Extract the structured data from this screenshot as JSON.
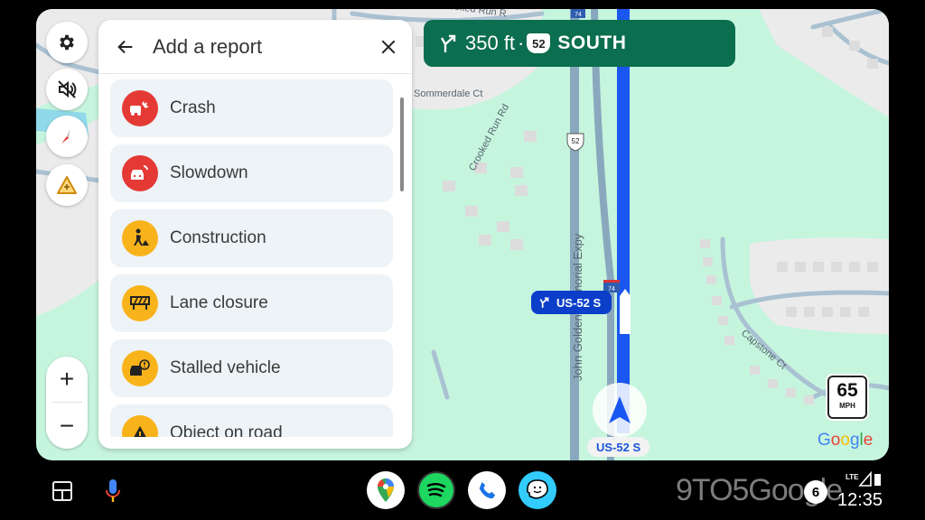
{
  "map": {
    "streets": [
      "Sommerdale Ct",
      "Crooked Run Rd",
      "John Golden Memorial Expy",
      "Capstone Ct",
      "Crooked Run Rd"
    ],
    "shields": [
      "52",
      "74",
      "74"
    ],
    "colors": {
      "land": "#c6f5de",
      "residential": "#ecebec",
      "road": "#9bb7c9",
      "route": "#1a56f0",
      "water": "#8fd9ea"
    }
  },
  "side_controls": {
    "settings": "gear-icon",
    "mute": "volume-off-icon",
    "compass": "compass-icon",
    "report": "report-incident-icon",
    "zoom_in": "+",
    "zoom_out": "−"
  },
  "panel": {
    "title": "Add a report",
    "back_icon": "arrow-left-icon",
    "close_icon": "close-icon",
    "items": [
      {
        "label": "Crash",
        "icon": "crash-icon",
        "color": "#e53935"
      },
      {
        "label": "Slowdown",
        "icon": "slowdown-icon",
        "color": "#e53935"
      },
      {
        "label": "Construction",
        "icon": "construction-icon",
        "color": "#f9b31a"
      },
      {
        "label": "Lane closure",
        "icon": "lane-closure-icon",
        "color": "#f9b31a"
      },
      {
        "label": "Stalled vehicle",
        "icon": "stalled-vehicle-icon",
        "color": "#f9b31a"
      },
      {
        "label": "Object on road",
        "icon": "hazard-icon",
        "color": "#f9b31a"
      }
    ]
  },
  "navigation": {
    "distance": "350 ft",
    "separator": "·",
    "route_shield": "52",
    "direction": "SOUTH",
    "color": "#0b6e4f",
    "callout": "US-52 S",
    "current_road": "US-52 S"
  },
  "speed_limit": {
    "value": "65",
    "unit": "MPH"
  },
  "google_logo": [
    "G",
    "o",
    "o",
    "g",
    "l",
    "e"
  ],
  "taskbar": {
    "apps": [
      "Google Maps",
      "Spotify",
      "Phone",
      "Waze"
    ],
    "watermark": "9TO5Google",
    "notification_count": "6",
    "network": "LTE",
    "time": "12:35"
  }
}
